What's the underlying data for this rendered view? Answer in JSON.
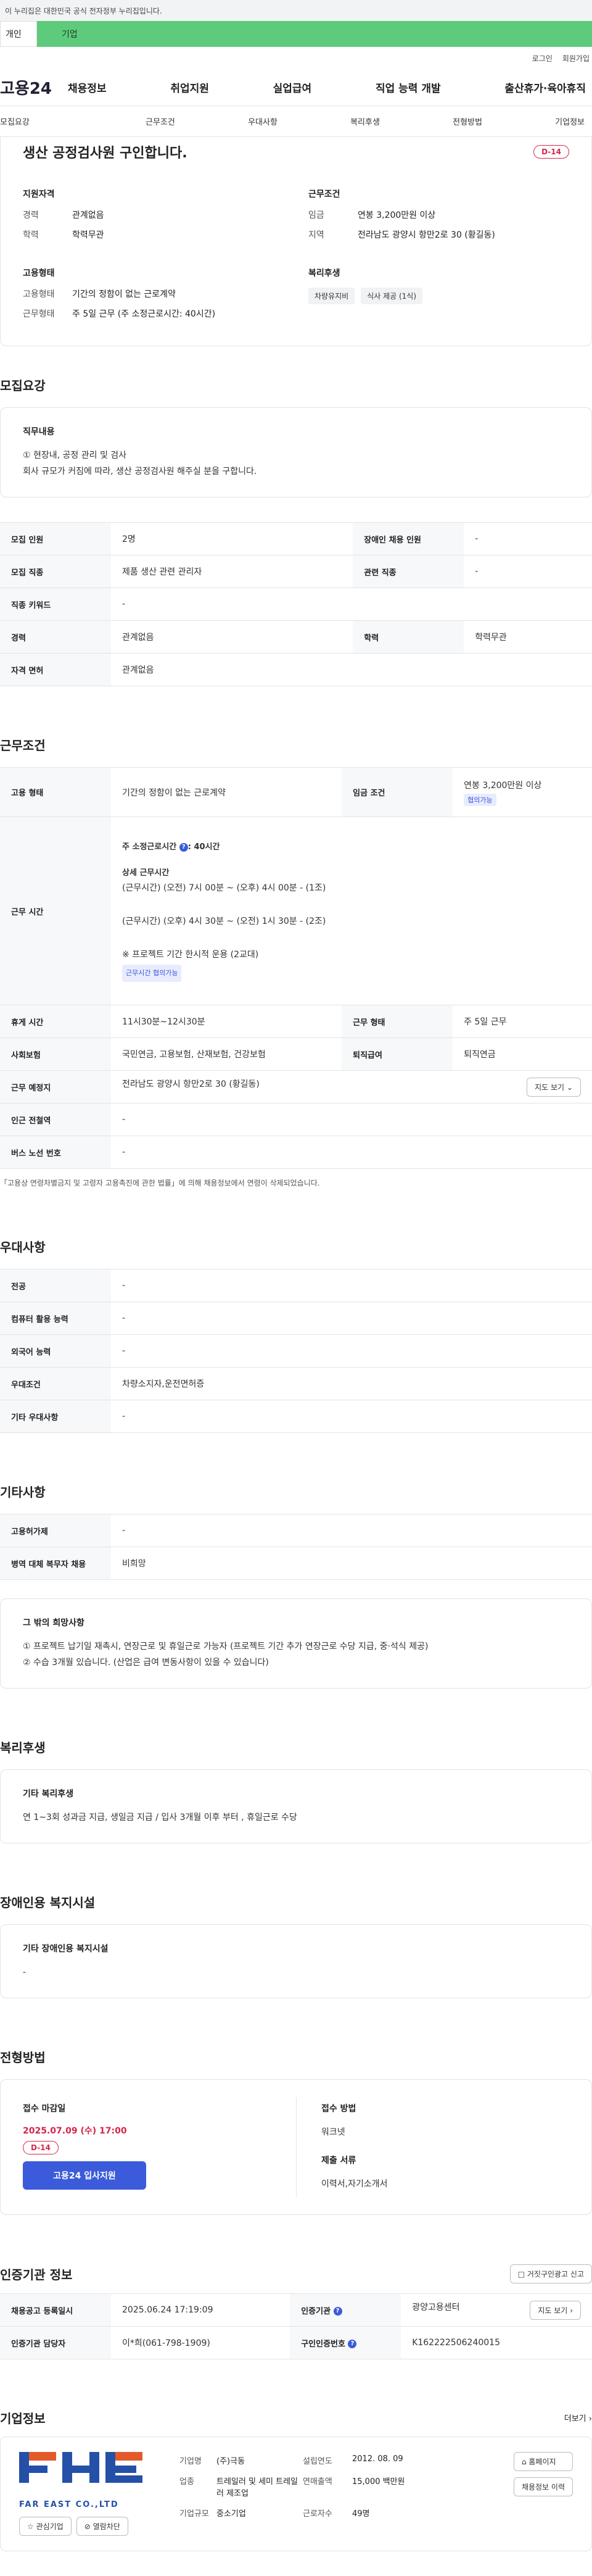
{
  "govbar": {
    "text": "이 누리집은 대한민국 공식 전자정부 누리집입니다."
  },
  "tabs": {
    "t1": "개인",
    "t2": "기업"
  },
  "util": {
    "login": "로그인",
    "signup": "회원가입"
  },
  "gnb": {
    "logo": "고용24",
    "menu": [
      "채용정보",
      "취업지원",
      "실업급여",
      "직업 능력 개발",
      "출산휴가·육아휴직"
    ]
  },
  "subnav": [
    "모집요강",
    "근무조건",
    "우대사항",
    "복리후생",
    "전형방법",
    "기업정보"
  ],
  "summary": {
    "title": "생산 공정검사원 구인합니다.",
    "dday": "D-14",
    "qual_title": "지원자격",
    "qual": [
      {
        "k": "경력",
        "v": "관계없음"
      },
      {
        "k": "학력",
        "v": "학력무관"
      }
    ],
    "cond_title": "근무조건",
    "cond": [
      {
        "k": "임금",
        "v": "연봉 3,200만원 이상"
      },
      {
        "k": "지역",
        "v": "전라남도 광양시 항만2로 30 (황길동)"
      }
    ],
    "emp_title": "고용형태",
    "emp": [
      {
        "k": "고용형태",
        "v": "기간의 정함이 없는 근로계약"
      },
      {
        "k": "근무형태",
        "v": "주 5일 근무 (주 소정근로시간: 40시간)"
      }
    ],
    "welfare_title": "복리후생",
    "welfare_chips": [
      "차량유지비",
      "식사 제공 (1식)"
    ]
  },
  "recruit": {
    "title": "모집요강",
    "duty_title": "직무내용",
    "duty_lines": [
      "① 현장내, 공정 관리 및 검사",
      "회사 규모가 커짐에 따라, 생산 공정검사원 해주실 분을 구합니다."
    ],
    "rows": [
      {
        "k1": "모집 인원",
        "v1": "2명",
        "k2": "장애인 채용 인원",
        "v2": "-"
      },
      {
        "k1": "모집 직종",
        "v1": "제품 생산 관련 관리자",
        "k2": "관련 직종",
        "v2": "-"
      },
      {
        "k1": "직종 키워드",
        "v1": "-"
      },
      {
        "k1": "경력",
        "v1": "관계없음",
        "k2": "학력",
        "v2": "학력무관"
      },
      {
        "k1": "자격 면허",
        "v1": "관계없음"
      }
    ]
  },
  "work": {
    "title": "근무조건",
    "emp_type_k": "고용 형태",
    "emp_type_v": "기간의 정함이 없는 근로계약",
    "wage_k": "임금 조건",
    "wage_v": "연봉 3,200만원 이상",
    "wage_badge": "협의가능",
    "hours_k": "근무 시간",
    "hours_weekly": "주 소정근로시간",
    "hours_weekly_v": ": 40시간",
    "hours_detail_title": "상세 근무시간",
    "hours_line1": "(근무시간) (오전) 7시 00분 ~ (오후) 4시 00분 - (1조)",
    "hours_line2": "(근무시간) (오후) 4시 30분 ~ (오전) 1시 30분 - (2조)",
    "hours_note": "※ 프로젝트 기간 한시적 운용 (2교대)",
    "hours_badge": "근무시간 협의가능",
    "rows": [
      {
        "k1": "휴게 시간",
        "v1": "11시30분~12시30분",
        "k2": "근무 형태",
        "v2": "주 5일 근무"
      },
      {
        "k1": "사회보험",
        "v1": "국민연금, 고용보험, 산재보험, 건강보험",
        "k2": "퇴직급여",
        "v2": "퇴직연금"
      }
    ],
    "place_k": "근무 예정지",
    "place_v": "전라남도 광양시 항만2로 30 (황길동)",
    "map_btn": "지도 보기",
    "station_k": "인근 전철역",
    "station_v": "-",
    "bus_k": "버스 노선 번호",
    "bus_v": "-",
    "note": "「고용상 연령차별금지 및 고령자 고용촉진에 관한 법률」에 의해 채용정보에서 연령이 삭제되었습니다."
  },
  "pref": {
    "title": "우대사항",
    "rows": [
      {
        "k": "전공",
        "v": "-"
      },
      {
        "k": "컴퓨터 활용 능력",
        "v": "-"
      },
      {
        "k": "외국어 능력",
        "v": "-"
      },
      {
        "k": "우대조건",
        "v": "차량소지자,운전면허증"
      },
      {
        "k": "기타 우대사항",
        "v": "-"
      }
    ]
  },
  "etc": {
    "title": "기타사항",
    "rows": [
      {
        "k": "고용허가제",
        "v": "-"
      },
      {
        "k": "병역 대체 복무자 채용",
        "v": "비희망"
      }
    ],
    "box_title": "그 밖의 희망사항",
    "box_lines": [
      "① 프로젝트 납기일 재촉시, 연장근로 및 휴일근로 가능자 (프로젝트 기간 추가 연장근로 수당 지급, 중·석식 제공)",
      "② 수습 3개월 있습니다. (산업은 급여 변동사항이 있을 수 있습니다)"
    ]
  },
  "welfare": {
    "title": "복리후생",
    "box_title": "기타 복리후생",
    "box_text": "연 1~3회 성과금 지급, 생일금 지급 / 입사 3개월 이후 부터 , 휴일근로 수당"
  },
  "disab": {
    "title": "장애인용 복지시설",
    "box_title": "기타 장애인용 복지시설",
    "box_text": "-"
  },
  "process": {
    "title": "전형방법",
    "deadline_k": "접수 마감일",
    "deadline_v": "2025.07.09 (수) 17:00",
    "dday": "D-14",
    "apply_btn": "고용24 입사지원",
    "method_k": "접수 방법",
    "method_v": "워크넷",
    "docs_k": "제출 서류",
    "docs_v": "이력서,자기소개서"
  },
  "agency": {
    "title": "인증기관 정보",
    "report_btn": "거짓구인광고 신고",
    "reg_k": "채용공고 등록일시",
    "reg_v": "2025.06.24 17:19:09",
    "org_k": "인증기관",
    "org_v": "광양고용센터",
    "map_btn": "지도 보기",
    "mgr_k": "인증기관 담당자",
    "mgr_v": "이*희(061-798-1909)",
    "id_k": "구인인증번호",
    "id_v": "K162222506240015"
  },
  "company": {
    "title": "기업정보",
    "more": "더보기",
    "logo_text": "FAR EAST CO.,LTD",
    "fav_btn": "관심기업",
    "block_btn": "열람차단",
    "name_k": "기업명",
    "name_v": "(주)극동",
    "ind_k": "업종",
    "ind_v": "트레일러 및 세미 트레일러 제조업",
    "size_k": "기업규모",
    "size_v": "중소기업",
    "est_k": "설립연도",
    "est_v": "2012. 08. 09",
    "sales_k": "연매출액",
    "sales_v": "15,000 백만원",
    "emp_k": "근로자수",
    "emp_v": "49명",
    "home_btn": "홈페이지",
    "jobs_btn": "채용정보 이력"
  },
  "colors": {
    "accent": "#3b5bdb",
    "dday": "#d4264b",
    "green": "#5ecb7c"
  }
}
